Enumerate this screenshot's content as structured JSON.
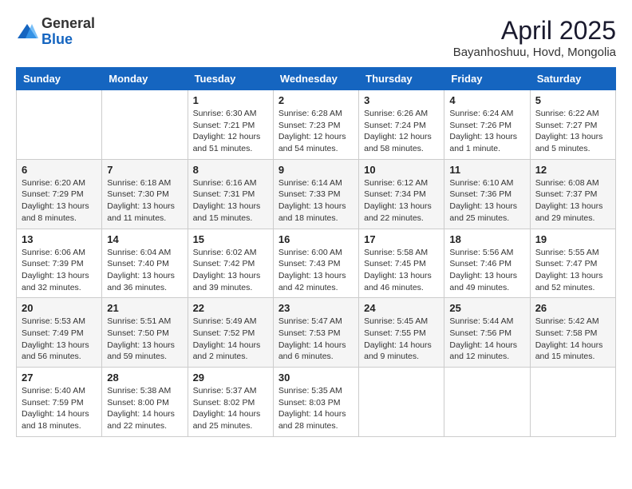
{
  "logo": {
    "general": "General",
    "blue": "Blue"
  },
  "title": {
    "month_year": "April 2025",
    "location": "Bayanhoshuu, Hovd, Mongolia"
  },
  "days_of_week": [
    "Sunday",
    "Monday",
    "Tuesday",
    "Wednesday",
    "Thursday",
    "Friday",
    "Saturday"
  ],
  "weeks": [
    [
      {
        "day": "",
        "info": ""
      },
      {
        "day": "",
        "info": ""
      },
      {
        "day": "1",
        "info": "Sunrise: 6:30 AM\nSunset: 7:21 PM\nDaylight: 12 hours and 51 minutes."
      },
      {
        "day": "2",
        "info": "Sunrise: 6:28 AM\nSunset: 7:23 PM\nDaylight: 12 hours and 54 minutes."
      },
      {
        "day": "3",
        "info": "Sunrise: 6:26 AM\nSunset: 7:24 PM\nDaylight: 12 hours and 58 minutes."
      },
      {
        "day": "4",
        "info": "Sunrise: 6:24 AM\nSunset: 7:26 PM\nDaylight: 13 hours and 1 minute."
      },
      {
        "day": "5",
        "info": "Sunrise: 6:22 AM\nSunset: 7:27 PM\nDaylight: 13 hours and 5 minutes."
      }
    ],
    [
      {
        "day": "6",
        "info": "Sunrise: 6:20 AM\nSunset: 7:29 PM\nDaylight: 13 hours and 8 minutes."
      },
      {
        "day": "7",
        "info": "Sunrise: 6:18 AM\nSunset: 7:30 PM\nDaylight: 13 hours and 11 minutes."
      },
      {
        "day": "8",
        "info": "Sunrise: 6:16 AM\nSunset: 7:31 PM\nDaylight: 13 hours and 15 minutes."
      },
      {
        "day": "9",
        "info": "Sunrise: 6:14 AM\nSunset: 7:33 PM\nDaylight: 13 hours and 18 minutes."
      },
      {
        "day": "10",
        "info": "Sunrise: 6:12 AM\nSunset: 7:34 PM\nDaylight: 13 hours and 22 minutes."
      },
      {
        "day": "11",
        "info": "Sunrise: 6:10 AM\nSunset: 7:36 PM\nDaylight: 13 hours and 25 minutes."
      },
      {
        "day": "12",
        "info": "Sunrise: 6:08 AM\nSunset: 7:37 PM\nDaylight: 13 hours and 29 minutes."
      }
    ],
    [
      {
        "day": "13",
        "info": "Sunrise: 6:06 AM\nSunset: 7:39 PM\nDaylight: 13 hours and 32 minutes."
      },
      {
        "day": "14",
        "info": "Sunrise: 6:04 AM\nSunset: 7:40 PM\nDaylight: 13 hours and 36 minutes."
      },
      {
        "day": "15",
        "info": "Sunrise: 6:02 AM\nSunset: 7:42 PM\nDaylight: 13 hours and 39 minutes."
      },
      {
        "day": "16",
        "info": "Sunrise: 6:00 AM\nSunset: 7:43 PM\nDaylight: 13 hours and 42 minutes."
      },
      {
        "day": "17",
        "info": "Sunrise: 5:58 AM\nSunset: 7:45 PM\nDaylight: 13 hours and 46 minutes."
      },
      {
        "day": "18",
        "info": "Sunrise: 5:56 AM\nSunset: 7:46 PM\nDaylight: 13 hours and 49 minutes."
      },
      {
        "day": "19",
        "info": "Sunrise: 5:55 AM\nSunset: 7:47 PM\nDaylight: 13 hours and 52 minutes."
      }
    ],
    [
      {
        "day": "20",
        "info": "Sunrise: 5:53 AM\nSunset: 7:49 PM\nDaylight: 13 hours and 56 minutes."
      },
      {
        "day": "21",
        "info": "Sunrise: 5:51 AM\nSunset: 7:50 PM\nDaylight: 13 hours and 59 minutes."
      },
      {
        "day": "22",
        "info": "Sunrise: 5:49 AM\nSunset: 7:52 PM\nDaylight: 14 hours and 2 minutes."
      },
      {
        "day": "23",
        "info": "Sunrise: 5:47 AM\nSunset: 7:53 PM\nDaylight: 14 hours and 6 minutes."
      },
      {
        "day": "24",
        "info": "Sunrise: 5:45 AM\nSunset: 7:55 PM\nDaylight: 14 hours and 9 minutes."
      },
      {
        "day": "25",
        "info": "Sunrise: 5:44 AM\nSunset: 7:56 PM\nDaylight: 14 hours and 12 minutes."
      },
      {
        "day": "26",
        "info": "Sunrise: 5:42 AM\nSunset: 7:58 PM\nDaylight: 14 hours and 15 minutes."
      }
    ],
    [
      {
        "day": "27",
        "info": "Sunrise: 5:40 AM\nSunset: 7:59 PM\nDaylight: 14 hours and 18 minutes."
      },
      {
        "day": "28",
        "info": "Sunrise: 5:38 AM\nSunset: 8:00 PM\nDaylight: 14 hours and 22 minutes."
      },
      {
        "day": "29",
        "info": "Sunrise: 5:37 AM\nSunset: 8:02 PM\nDaylight: 14 hours and 25 minutes."
      },
      {
        "day": "30",
        "info": "Sunrise: 5:35 AM\nSunset: 8:03 PM\nDaylight: 14 hours and 28 minutes."
      },
      {
        "day": "",
        "info": ""
      },
      {
        "day": "",
        "info": ""
      },
      {
        "day": "",
        "info": ""
      }
    ]
  ]
}
